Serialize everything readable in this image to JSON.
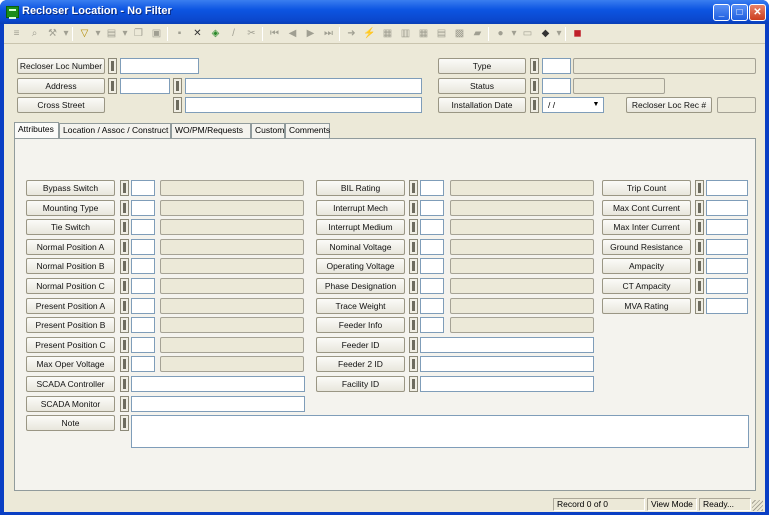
{
  "window": {
    "title": "Recloser Location - No Filter",
    "minimize": "_",
    "maximize": "□",
    "close": "✕"
  },
  "toolbar_icons": [
    "list-view-icon",
    "search-icon",
    "tools-icon",
    "dropdown-icon",
    "filter-icon",
    "dropdown-icon",
    "edit-icon",
    "dropdown-icon",
    "copy-icon",
    "paste-icon",
    "save-icon",
    "delete-icon",
    "refresh-icon",
    "edit-pen-icon",
    "cut-icon",
    "first-record-icon",
    "previous-record-icon",
    "next-record-icon",
    "last-record-icon",
    "goto-icon",
    "flash-icon",
    "report-icon",
    "report2-icon",
    "grid-icon",
    "form-icon",
    "chart-icon",
    "folder-icon",
    "globe-icon",
    "dropdown-icon",
    "card-icon",
    "book-icon",
    "dropdown-icon",
    "exit-icon"
  ],
  "header": {
    "recloser_loc_number": {
      "label": "Recloser Loc Number",
      "value": ""
    },
    "address": {
      "label": "Address",
      "value1": "",
      "value2": ""
    },
    "cross_street": {
      "label": "Cross Street",
      "value": ""
    },
    "type": {
      "label": "Type",
      "code": "",
      "description": ""
    },
    "status": {
      "label": "Status",
      "code": "",
      "description": ""
    },
    "installation_date": {
      "label": "Installation Date",
      "value": " / /"
    },
    "recloser_loc_rec": {
      "label": "Recloser Loc Rec #",
      "value": ""
    }
  },
  "tabs": [
    "Attributes",
    "Location / Assoc / Construct",
    "WO/PM/Requests",
    "Custom",
    "Comments"
  ],
  "active_tab": "Attributes",
  "attributes": {
    "col1": [
      "Bypass Switch",
      "Mounting Type",
      "Tie Switch",
      "Normal Position A",
      "Normal Position B",
      "Normal Position C",
      "Present Position A",
      "Present Position B",
      "Present Position C",
      "Max Oper Voltage"
    ],
    "scada_controller": "SCADA Controller",
    "scada_monitor": "SCADA Monitor",
    "note": "Note",
    "col2": [
      "BIL Rating",
      "Interrupt Mech",
      "Interrupt Medium",
      "Nominal Voltage",
      "Operating Voltage",
      "Phase Designation",
      "Trace Weight",
      "Feeder Info"
    ],
    "feeder_id": "Feeder ID",
    "feeder2_id": "Feeder 2 ID",
    "facility_id": "Facility ID",
    "col3": [
      "Trip Count",
      "Max Cont Current",
      "Max Inter Current",
      "Ground Resistance",
      "Ampacity",
      "CT Ampacity",
      "MVA Rating"
    ]
  },
  "statusbar": {
    "record": "Record 0 of 0",
    "mode": "View Mode",
    "state": "Ready..."
  }
}
